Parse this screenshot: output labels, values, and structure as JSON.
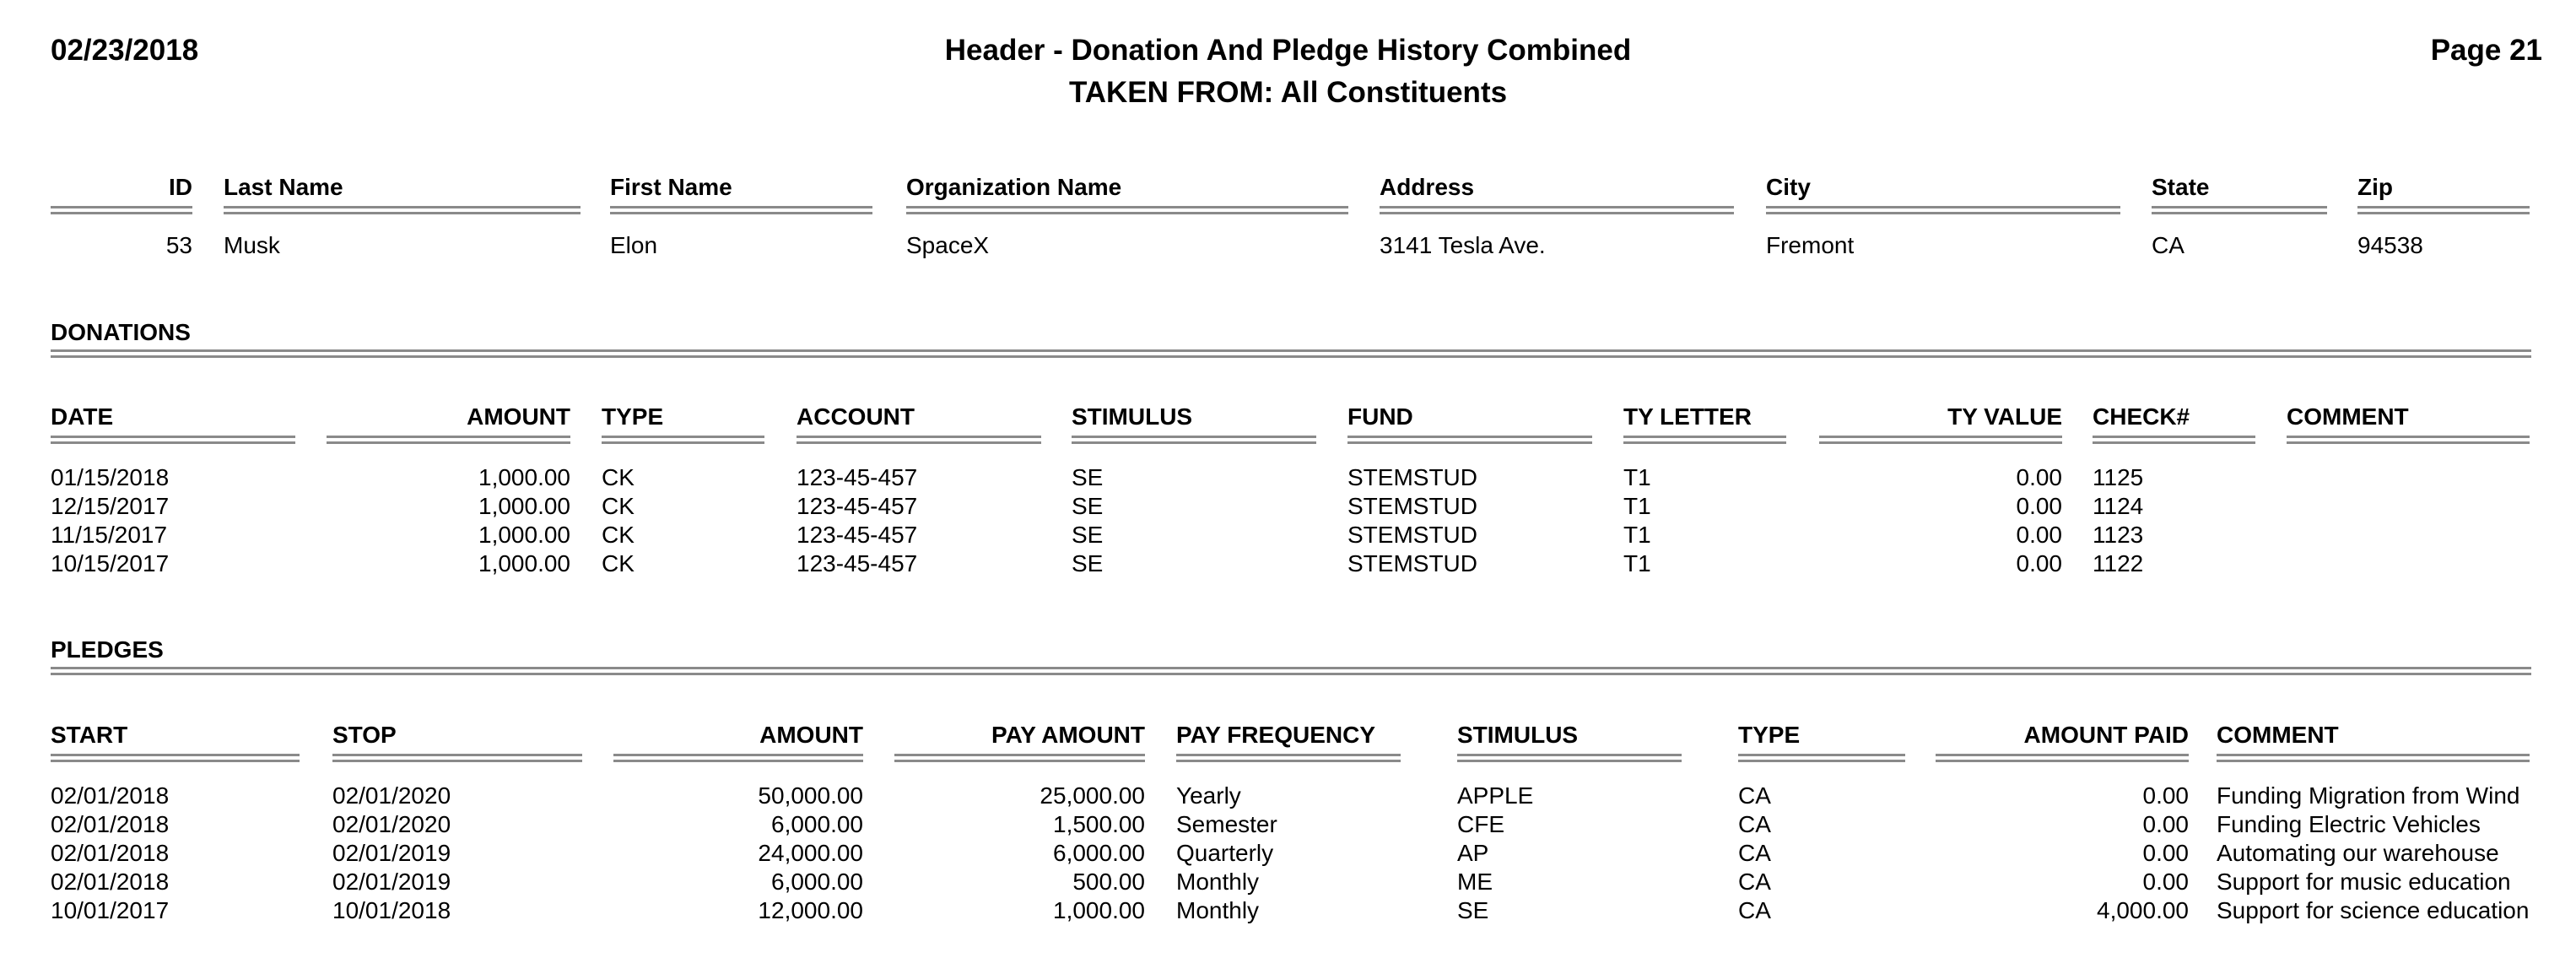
{
  "header": {
    "date": "02/23/2018",
    "title": "Header - Donation And Pledge History Combined",
    "subtitle": "TAKEN FROM: All Constituents",
    "page": "Page 21"
  },
  "constituent": {
    "columns": [
      "ID",
      "Last Name",
      "First Name",
      "Organization Name",
      "Address",
      "City",
      "State",
      "Zip"
    ],
    "values": [
      "53",
      "Musk",
      "Elon",
      "SpaceX",
      "3141 Tesla Ave.",
      "Fremont",
      "CA",
      "94538"
    ]
  },
  "donations": {
    "title": "DONATIONS",
    "columns": [
      "DATE",
      "AMOUNT",
      "TYPE",
      "ACCOUNT",
      "STIMULUS",
      "FUND",
      "TY LETTER",
      "TY VALUE",
      "CHECK#",
      "COMMENT"
    ],
    "rows": [
      [
        "01/15/2018",
        "1,000.00",
        "CK",
        "123-45-457",
        "SE",
        "STEMSTUD",
        "T1",
        "0.00",
        "1125",
        ""
      ],
      [
        "12/15/2017",
        "1,000.00",
        "CK",
        "123-45-457",
        "SE",
        "STEMSTUD",
        "T1",
        "0.00",
        "1124",
        ""
      ],
      [
        "11/15/2017",
        "1,000.00",
        "CK",
        "123-45-457",
        "SE",
        "STEMSTUD",
        "T1",
        "0.00",
        "1123",
        ""
      ],
      [
        "10/15/2017",
        "1,000.00",
        "CK",
        "123-45-457",
        "SE",
        "STEMSTUD",
        "T1",
        "0.00",
        "1122",
        ""
      ]
    ]
  },
  "pledges": {
    "title": "PLEDGES",
    "columns": [
      "START",
      "STOP",
      "AMOUNT",
      "PAY AMOUNT",
      "PAY FREQUENCY",
      "STIMULUS",
      "TYPE",
      "AMOUNT PAID",
      "COMMENT"
    ],
    "rows": [
      [
        "02/01/2018",
        "02/01/2020",
        "50,000.00",
        "25,000.00",
        "Yearly",
        "APPLE",
        "CA",
        "0.00",
        "Funding Migration from Wind"
      ],
      [
        "02/01/2018",
        "02/01/2020",
        "6,000.00",
        "1,500.00",
        "Semester",
        "CFE",
        "CA",
        "0.00",
        "Funding Electric Vehicles"
      ],
      [
        "02/01/2018",
        "02/01/2019",
        "24,000.00",
        "6,000.00",
        "Quarterly",
        "AP",
        "CA",
        "0.00",
        "Automating our warehouse"
      ],
      [
        "02/01/2018",
        "02/01/2019",
        "6,000.00",
        "500.00",
        "Monthly",
        "ME",
        "CA",
        "0.00",
        "Support for music education"
      ],
      [
        "10/01/2017",
        "10/01/2018",
        "12,000.00",
        "1,000.00",
        "Monthly",
        "SE",
        "CA",
        "4,000.00",
        "Support for science education"
      ]
    ]
  }
}
